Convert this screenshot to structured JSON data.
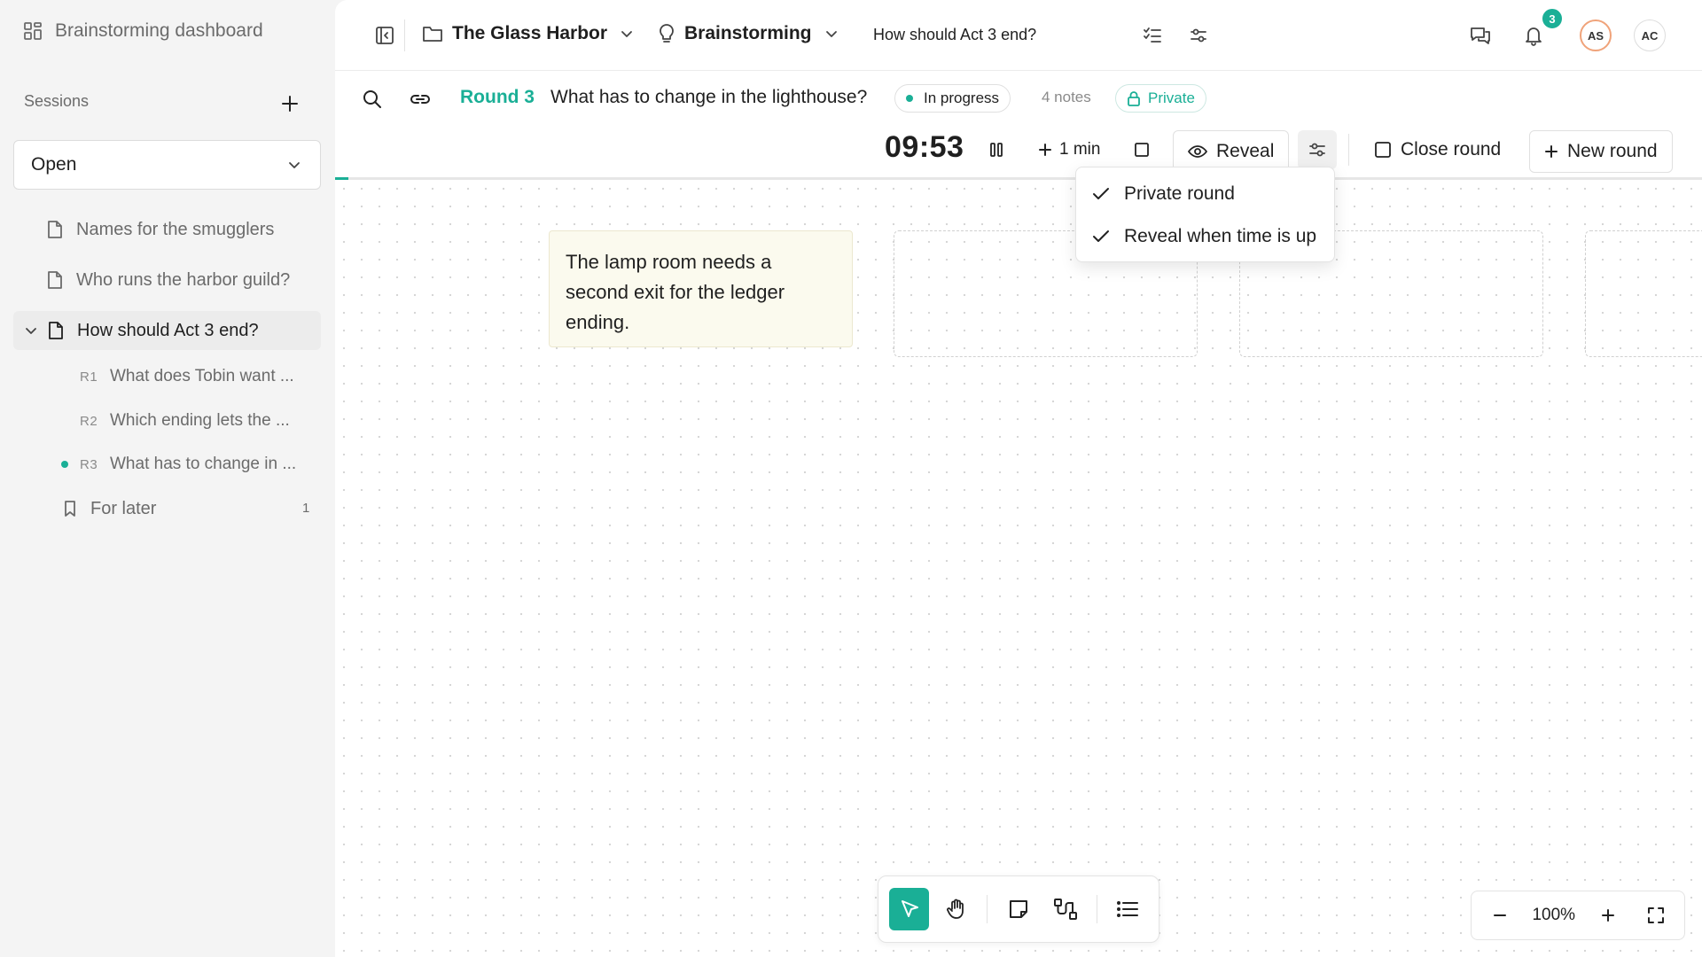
{
  "sidebar": {
    "dashboard_label": "Brainstorming dashboard",
    "sessions_label": "Sessions",
    "filter_value": "Open",
    "docs": [
      {
        "label": "Names for the smugglers"
      },
      {
        "label": "Who runs the harbor guild?"
      },
      {
        "label": "How should Act 3 end?"
      }
    ],
    "rounds": [
      {
        "tag": "R1",
        "label": "What does Tobin want ..."
      },
      {
        "tag": "R2",
        "label": "Which ending lets the ..."
      },
      {
        "tag": "R3",
        "label": "What has to change in ..."
      }
    ],
    "for_later": {
      "label": "For later",
      "count": "1"
    }
  },
  "topbar": {
    "project": "The Glass Harbor",
    "mode": "Brainstorming",
    "question": "How should Act 3 end?",
    "notifications": "3",
    "avatar_1": "AS",
    "avatar_2": "AC"
  },
  "round": {
    "label": "Round 3",
    "question": "What has to change in the lighthouse?",
    "status": "In progress",
    "notes_count": "4 notes",
    "visibility": "Private"
  },
  "controls": {
    "timer": "09:53",
    "add_time": "1 min",
    "reveal": "Reveal",
    "close_round": "Close round",
    "new_round": "New round",
    "progress": 0.01
  },
  "dropdown": {
    "items": [
      {
        "label": "Private round"
      },
      {
        "label": "Reveal when time is up"
      }
    ]
  },
  "canvas": {
    "note_text": "The lamp room needs a second exit for the ledger ending."
  },
  "zoom": {
    "value": "100%"
  },
  "colors": {
    "accent": "#1aaf96",
    "avatar_1_ring": "#f0a37a"
  }
}
